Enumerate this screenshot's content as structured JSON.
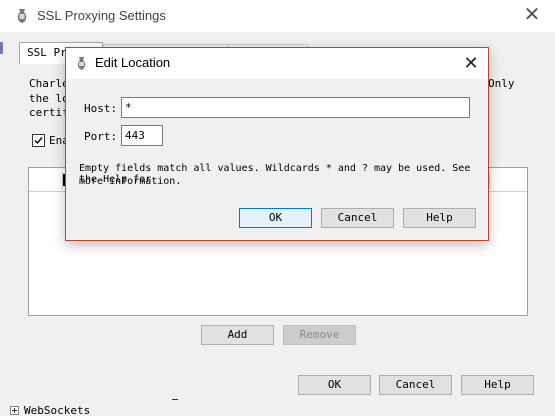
{
  "window": {
    "title": "SSL Proxying Settings",
    "close_glyph": "✕"
  },
  "tabs": [
    {
      "label": "SSL Pro"
    }
  ],
  "panel": {
    "description_line1": "Charle",
    "description_line1_right": "Only",
    "description_line2": "the lo",
    "description_line3": "certif",
    "enable_label": "Ena",
    "header_fragment": ""
  },
  "panel_buttons": {
    "add_label": "Add",
    "remove_label": "Remove"
  },
  "footer_buttons": {
    "ok_label": "OK",
    "cancel_label": "Cancel",
    "help_label": "Help"
  },
  "tree": {
    "item_label": "WebSockets"
  },
  "dialog": {
    "title": "Edit Location",
    "close_glyph": "✕",
    "host_label": "Host:",
    "host_value": "*",
    "port_label": "Port:",
    "port_value": "443",
    "note_line1": "Empty fields match all values. Wildcards * and ? may be used. See the Help for",
    "note_line2": "more information.",
    "ok_label": "OK",
    "cancel_label": "Cancel",
    "help_label": "Help"
  },
  "colors": {
    "dialog_border": "#b9442d",
    "focus_border": "#0078d7",
    "window_bg": "#f0f0f0"
  },
  "icons": {
    "app_icon": "charles-vase-icon",
    "checkbox": "checkmark-icon",
    "tree_toggle": "tree-expand-icon"
  }
}
